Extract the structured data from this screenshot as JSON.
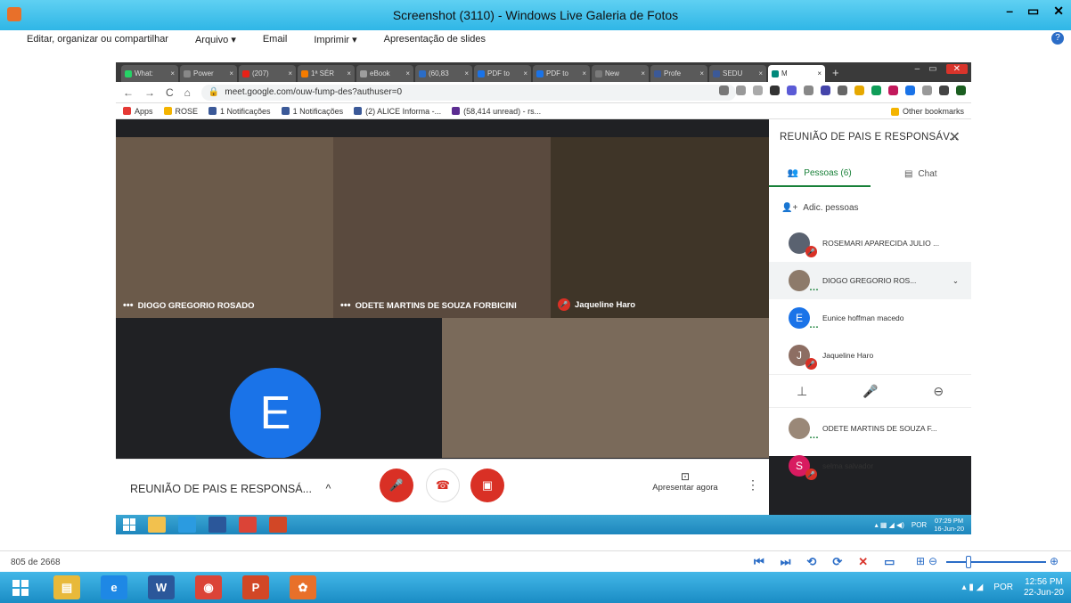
{
  "window": {
    "title": "Screenshot (3110) - Windows Live Galeria de Fotos",
    "controls": [
      "–",
      "▭",
      "✕"
    ]
  },
  "menu": {
    "items": [
      "Editar, organizar ou compartilhar",
      "Arquivo ▾",
      "Email",
      "Imprimir ▾",
      "Apresentação de slides"
    ],
    "help": "?"
  },
  "browser": {
    "tabs": [
      {
        "label": "What:",
        "color": "#25d366"
      },
      {
        "label": "Power",
        "color": "#888888"
      },
      {
        "label": "(207)",
        "color": "#e62117"
      },
      {
        "label": "1ª SÉR",
        "color": "#f57c00"
      },
      {
        "label": "eBook",
        "color": "#9e9e9e"
      },
      {
        "label": "(60,83",
        "color": "#2b6dc7"
      },
      {
        "label": "PDF to",
        "color": "#1a73e8"
      },
      {
        "label": "PDF to",
        "color": "#1a73e8"
      },
      {
        "label": "New",
        "color": "#7a7a7a"
      },
      {
        "label": "Profe",
        "color": "#3b5998"
      },
      {
        "label": "SEDU",
        "color": "#3b5998"
      },
      {
        "label": "M",
        "color": "#00897b",
        "active": true
      }
    ],
    "new_tab": "+",
    "window_controls": [
      "–",
      "▭",
      "✕"
    ],
    "nav": [
      "←",
      "→",
      "C",
      "⌂"
    ],
    "url": "meet.google.com/ouw-fump-des?authuser=0",
    "extension_colors": [
      "#777777",
      "#999999",
      "#aaaaaa",
      "#333333",
      "#5b5bd6",
      "#888888",
      "#44a",
      "#666666",
      "#e6a800",
      "#0f9d58",
      "#c2185b",
      "#1a73e8",
      "#999999",
      "#444444",
      "#1b5e20"
    ],
    "bookmarks": [
      {
        "label": "Apps",
        "color": "#e53935"
      },
      {
        "label": "ROSE",
        "color": "#f4b400"
      },
      {
        "label": "1 Notificações",
        "color": "#3b5998"
      },
      {
        "label": "1 Notificações",
        "color": "#3b5998"
      },
      {
        "label": "(2) ALICE Informa -...",
        "color": "#3b5998"
      },
      {
        "label": "(58,414 unread) - rs...",
        "color": "#5b2c91"
      }
    ],
    "other_bookmarks": "Other bookmarks"
  },
  "meet": {
    "tiles": [
      {
        "name": "DIOGO GREGORIO ROSADO",
        "speaking": true,
        "muted": false,
        "bg": "#6b5a4a"
      },
      {
        "name": "ODETE MARTINS DE SOUZA FORBICINI",
        "speaking": true,
        "muted": false,
        "bg": "#5a4a3e"
      },
      {
        "name": "Jaqueline Haro",
        "speaking": false,
        "muted": true,
        "bg": "#3f3528"
      },
      {
        "name": "",
        "speaking": false,
        "muted": false,
        "bg": "#202124"
      },
      {
        "name": "",
        "speaking": false,
        "muted": false,
        "bg": "#7a6a5a"
      }
    ],
    "big_avatar_letter": "E",
    "meeting_title": "REUNIÃO DE PAIS E RESPONSÁ...",
    "chevron": "^",
    "present_label": "Apresentar agora",
    "more": "⋮"
  },
  "side_panel": {
    "title": "REUNIÃO DE PAIS E RESPONSÁV...",
    "close": "✕",
    "tab_people": "Pessoas (6)",
    "tab_chat": "Chat",
    "add_people": "Adic. pessoas",
    "participants": [
      {
        "name": "ROSEMARI APARECIDA JULIO ...",
        "initial": "",
        "color": "#5a6270",
        "muted": true,
        "speaking": false
      },
      {
        "name": "DIOGO GREGORIO ROS...",
        "initial": "",
        "color": "#8d7a6a",
        "muted": false,
        "speaking": true,
        "expanded": true
      },
      {
        "name": "Eunice hoffman macedo",
        "initial": "E",
        "color": "#1a73e8",
        "muted": false,
        "speaking": true
      },
      {
        "name": "Jaqueline Haro",
        "initial": "J",
        "color": "#8d6e63",
        "muted": true,
        "speaking": false
      },
      {
        "name": "ODETE MARTINS DE SOUZA F...",
        "initial": "",
        "color": "#9a8878",
        "muted": false,
        "speaking": true
      },
      {
        "name": "selma salvador",
        "initial": "S",
        "color": "#d81b60",
        "muted": true,
        "speaking": false
      }
    ],
    "actions": [
      "pin",
      "mic-off",
      "remove"
    ],
    "expand_icon": "⌄"
  },
  "inner_taskbar": {
    "apps": [
      {
        "name": "explorer",
        "color": "#f2c14e"
      },
      {
        "name": "ie",
        "color": "#2b9be0"
      },
      {
        "name": "word",
        "color": "#2b579a"
      },
      {
        "name": "chrome",
        "color": "#db4437"
      },
      {
        "name": "powerpoint",
        "color": "#d24726"
      }
    ],
    "lang": "POR",
    "time": "07:29 PM",
    "date": "16-Jun-20"
  },
  "status_bar": {
    "page_count": "805 de 2668",
    "controls": [
      "⏮",
      "⏭",
      "⟲",
      "⟳",
      "✕",
      "▭",
      "⊞"
    ],
    "zoom_minus": "⊖",
    "zoom_plus": "⊕",
    "zoom_level": 0.2
  },
  "taskbar": {
    "apps": [
      {
        "name": "explorer",
        "glyph": "▤",
        "color": "#e8b93a"
      },
      {
        "name": "ie",
        "glyph": "e",
        "color": "#1e88e5"
      },
      {
        "name": "word",
        "glyph": "W",
        "color": "#2b579a"
      },
      {
        "name": "chrome",
        "glyph": "◉",
        "color": "#db4437"
      },
      {
        "name": "powerpoint",
        "glyph": "P",
        "color": "#d24726"
      },
      {
        "name": "photo-gallery",
        "glyph": "✿",
        "color": "#e8702a"
      }
    ],
    "lang": "POR",
    "time": "12:56 PM",
    "date": "22-Jun-20"
  }
}
